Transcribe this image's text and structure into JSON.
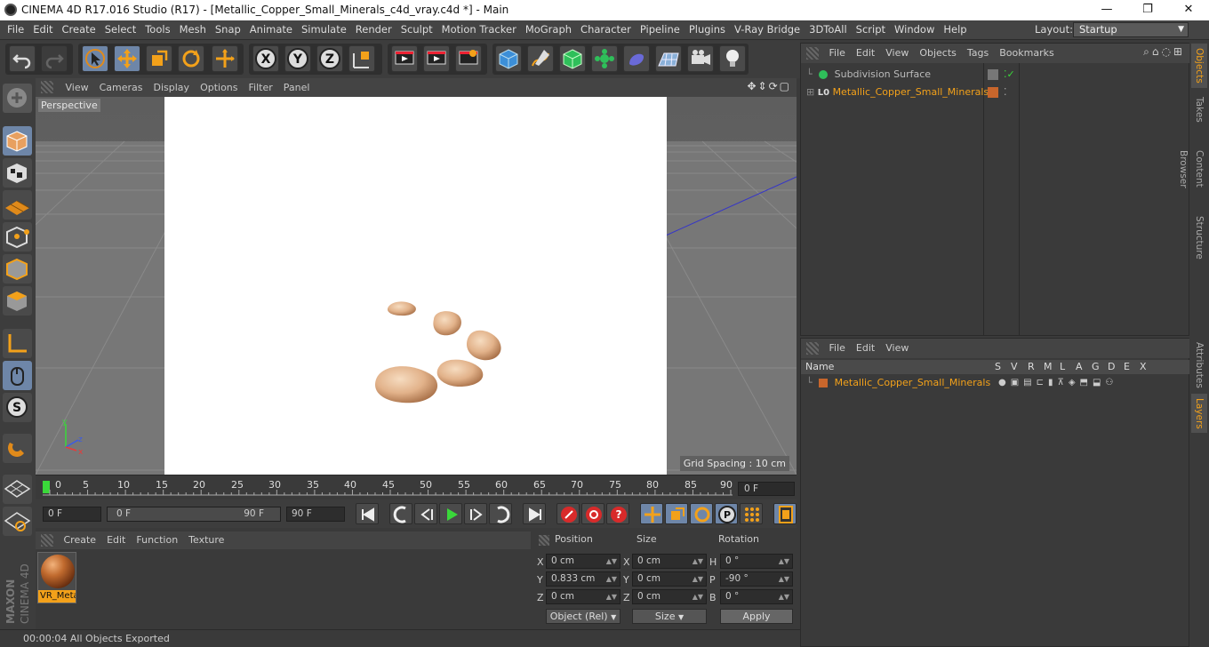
{
  "window": {
    "title": "CINEMA 4D R17.016 Studio (R17) - [Metallic_Copper_Small_Minerals_c4d_vray.c4d *] - Main",
    "minimize": "—",
    "maximize": "❐",
    "close": "✕"
  },
  "menubar": {
    "items": [
      "File",
      "Edit",
      "Create",
      "Select",
      "Tools",
      "Mesh",
      "Snap",
      "Animate",
      "Simulate",
      "Render",
      "Sculpt",
      "Motion Tracker",
      "MoGraph",
      "Character",
      "Pipeline",
      "Plugins",
      "V-Ray Bridge",
      "3DToAll",
      "Script",
      "Window",
      "Help"
    ],
    "layout_label": "Layout:",
    "layout_value": "Startup"
  },
  "viewport": {
    "menu": [
      "View",
      "Cameras",
      "Display",
      "Options",
      "Filter",
      "Panel"
    ],
    "label": "Perspective",
    "grid_spacing": "Grid Spacing : 10 cm"
  },
  "timeline": {
    "ticks": [
      "0",
      "5",
      "10",
      "15",
      "20",
      "25",
      "30",
      "35",
      "40",
      "45",
      "50",
      "55",
      "60",
      "65",
      "70",
      "75",
      "80",
      "85",
      "90"
    ],
    "current_frame": "0 F"
  },
  "transport": {
    "start": "0 F",
    "range_start": "0 F",
    "range_end": "90 F",
    "end": "90 F"
  },
  "material_manager": {
    "menu": [
      "Create",
      "Edit",
      "Function",
      "Texture"
    ],
    "materials": [
      {
        "name": "VR_Metal"
      }
    ]
  },
  "coordinates": {
    "headers": {
      "position": "Position",
      "size": "Size",
      "rotation": "Rotation"
    },
    "position": {
      "x": "0 cm",
      "y": "0.833 cm",
      "z": "0 cm"
    },
    "size": {
      "x": "0 cm",
      "y": "0 cm",
      "z": "0 cm"
    },
    "rotation": {
      "h": "0 °",
      "p": "-90 °",
      "b": "0 °"
    },
    "axis_x": "X",
    "axis_y": "Y",
    "axis_z": "Z",
    "axis_h": "H",
    "axis_p": "P",
    "axis_b": "B",
    "mode": "Object (Rel)",
    "size_mode": "Size",
    "apply": "Apply"
  },
  "status": {
    "text": "00:00:04 All Objects Exported"
  },
  "branding": {
    "maxon": "MAXON",
    "product": "CINEMA 4D"
  },
  "object_manager": {
    "menu": [
      "File",
      "Edit",
      "View",
      "Objects",
      "Tags",
      "Bookmarks"
    ],
    "objects": [
      {
        "name": "Subdivision Surface"
      },
      {
        "name": "Metallic_Copper_Small_Minerals"
      }
    ],
    "layer_badge": "L0"
  },
  "layer_manager": {
    "menu": [
      "File",
      "Edit",
      "View"
    ],
    "columns": [
      "Name",
      "S",
      "V",
      "R",
      "M",
      "L",
      "A",
      "G",
      "D",
      "E",
      "X"
    ],
    "layers": [
      {
        "name": "Metallic_Copper_Small_Minerals",
        "color": "#c8662c"
      }
    ]
  },
  "right_tabs": {
    "top": [
      "Objects",
      "Takes",
      "Content Browser",
      "Structure"
    ],
    "bottom": [
      "Attributes",
      "Layers"
    ]
  },
  "colors": {
    "accent_orange": "#f3a11a",
    "copper": "#e0b48c",
    "selected_blue": "#6e86a8"
  }
}
